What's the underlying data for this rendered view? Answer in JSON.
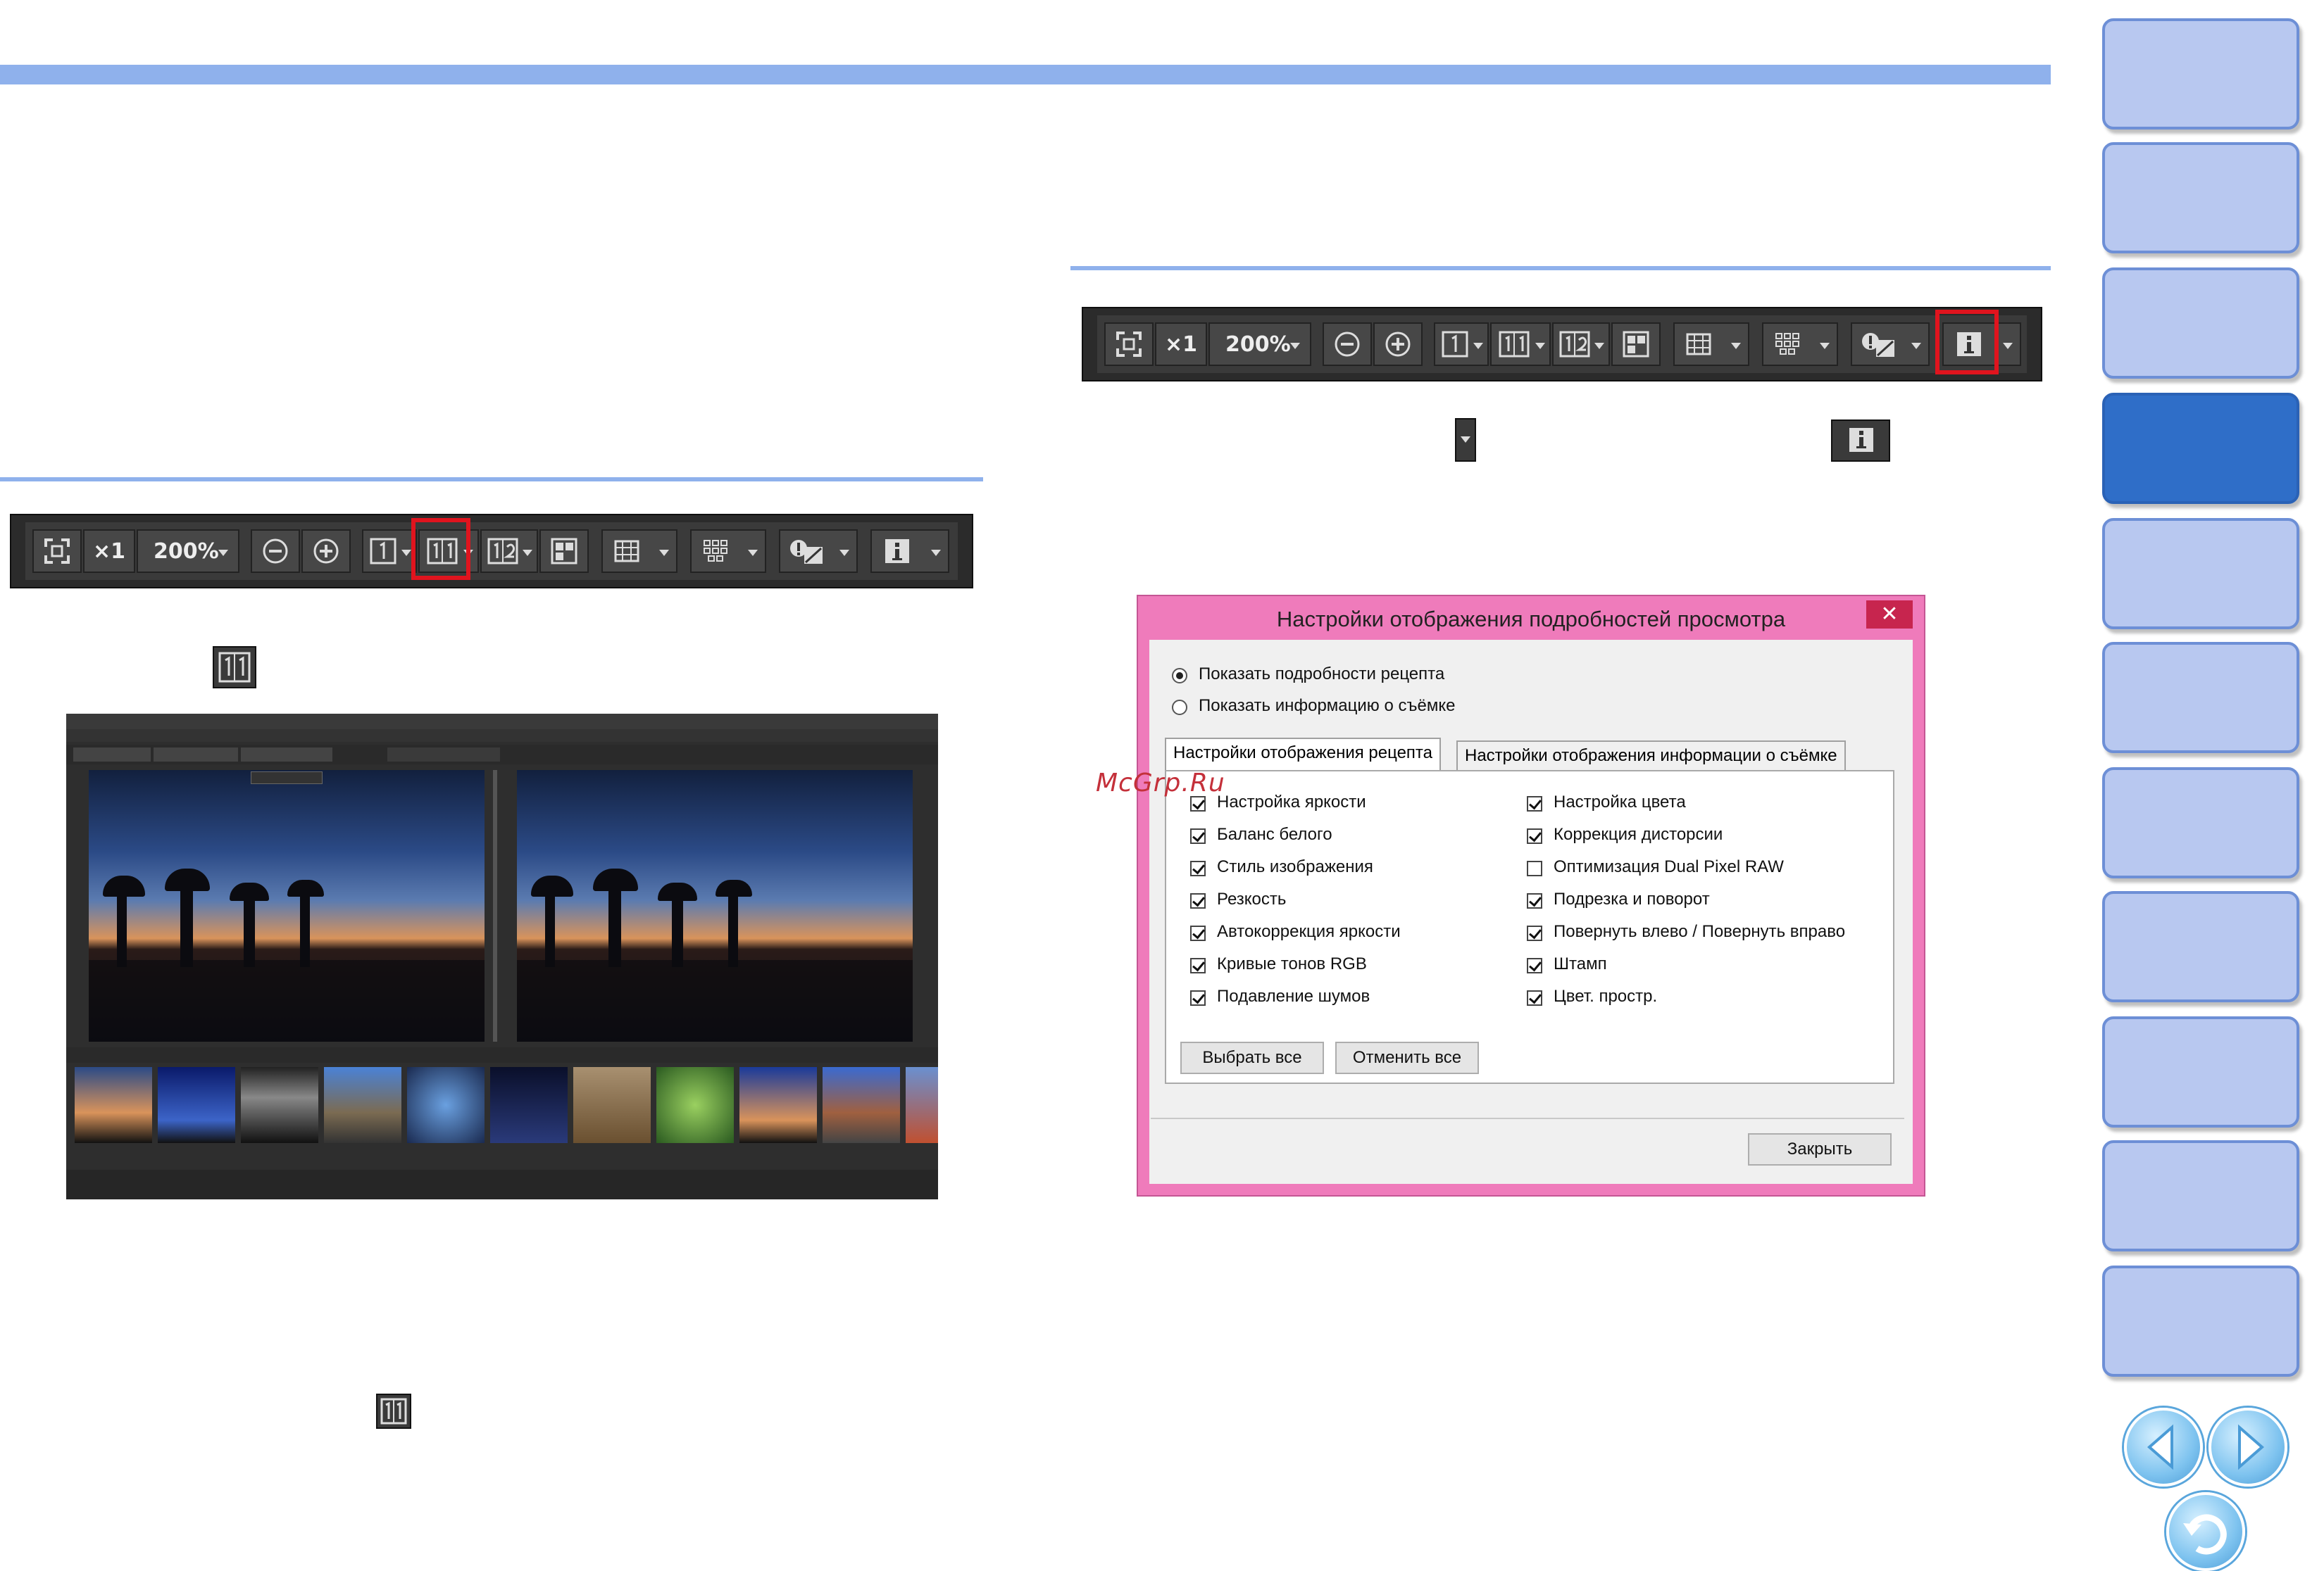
{
  "toolbar": {
    "fit_label": "",
    "x1_label": "×1",
    "zoom_label": "200%"
  },
  "dialog": {
    "title": "Настройки отображения подробностей просмотра",
    "close_label": "✕",
    "radio_recipe": "Показать подробности рецепта",
    "radio_shooting": "Показать информацию о съёмке",
    "tab_recipe": "Настройки отображения рецепта",
    "tab_shooting": "Настройки отображения информации о съёмке",
    "left_items": [
      {
        "label": "Настройка яркости",
        "checked": true
      },
      {
        "label": "Баланс белого",
        "checked": true
      },
      {
        "label": "Стиль изображения",
        "checked": true
      },
      {
        "label": "Резкость",
        "checked": true
      },
      {
        "label": "Автокоррекция яркости",
        "checked": true
      },
      {
        "label": "Кривые тонов RGB",
        "checked": true
      },
      {
        "label": "Подавление шумов",
        "checked": true
      }
    ],
    "right_items": [
      {
        "label": "Настройка цвета",
        "checked": true
      },
      {
        "label": "Коррекция дисторсии",
        "checked": true
      },
      {
        "label": "Оптимизация Dual Pixel RAW",
        "checked": false
      },
      {
        "label": "Подрезка и поворот",
        "checked": true
      },
      {
        "label": "Повернуть влево / Повернуть вправо",
        "checked": true
      },
      {
        "label": "Штамп",
        "checked": true
      },
      {
        "label": "Цвет. простр.",
        "checked": true
      }
    ],
    "select_all": "Выбрать все",
    "cancel_all": "Отменить все",
    "close_button": "Закрыть"
  },
  "watermark": "McGrp.Ru",
  "colors": {
    "accent_blue": "#8fb1ec",
    "side_tab": "#b8c8f0",
    "side_tab_active": "#2f6ec8",
    "highlight_red": "#e0141e",
    "dialog_frame": "#ef7bbb"
  },
  "icons": [
    "fit-screen-icon",
    "zoom-out-icon",
    "zoom-in-icon",
    "single-view-icon",
    "compare-view-icon",
    "two-view-icon",
    "multi-view-icon",
    "grid-icon",
    "af-points-icon",
    "highlight-warning-icon",
    "info-icon",
    "prev-page-icon",
    "next-page-icon",
    "return-icon"
  ]
}
